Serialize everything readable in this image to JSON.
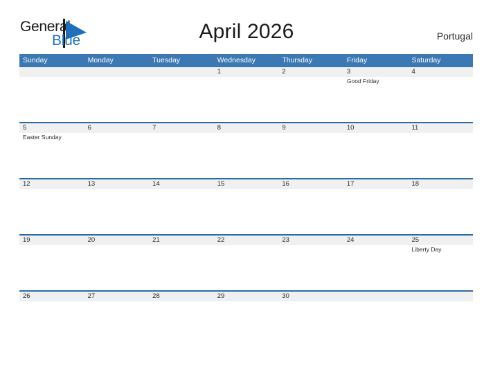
{
  "header": {
    "logo": {
      "word_one": "General",
      "word_two": "Blue",
      "flag_icon": "blue-triangle-flag-icon",
      "brand_color": "#1f6fba"
    },
    "title": "April 2026",
    "country": "Portugal"
  },
  "calendar": {
    "month": "April",
    "year": "2026",
    "header_color": "#3b78b4",
    "row_divider_color": "#2b6ca3",
    "day_strip_color": "#f0f0f0",
    "weekdays": [
      "Sunday",
      "Monday",
      "Tuesday",
      "Wednesday",
      "Thursday",
      "Friday",
      "Saturday"
    ],
    "weeks": [
      {
        "days": [
          {
            "num": "",
            "events": []
          },
          {
            "num": "",
            "events": []
          },
          {
            "num": "",
            "events": []
          },
          {
            "num": "1",
            "events": []
          },
          {
            "num": "2",
            "events": []
          },
          {
            "num": "3",
            "events": [
              "Good Friday"
            ]
          },
          {
            "num": "4",
            "events": []
          }
        ]
      },
      {
        "days": [
          {
            "num": "5",
            "events": [
              "Easter Sunday"
            ]
          },
          {
            "num": "6",
            "events": []
          },
          {
            "num": "7",
            "events": []
          },
          {
            "num": "8",
            "events": []
          },
          {
            "num": "9",
            "events": []
          },
          {
            "num": "10",
            "events": []
          },
          {
            "num": "11",
            "events": []
          }
        ]
      },
      {
        "days": [
          {
            "num": "12",
            "events": []
          },
          {
            "num": "13",
            "events": []
          },
          {
            "num": "14",
            "events": []
          },
          {
            "num": "15",
            "events": []
          },
          {
            "num": "16",
            "events": []
          },
          {
            "num": "17",
            "events": []
          },
          {
            "num": "18",
            "events": []
          }
        ]
      },
      {
        "days": [
          {
            "num": "19",
            "events": []
          },
          {
            "num": "20",
            "events": []
          },
          {
            "num": "21",
            "events": []
          },
          {
            "num": "22",
            "events": []
          },
          {
            "num": "23",
            "events": []
          },
          {
            "num": "24",
            "events": []
          },
          {
            "num": "25",
            "events": [
              "Liberty Day"
            ]
          }
        ]
      },
      {
        "days": [
          {
            "num": "26",
            "events": []
          },
          {
            "num": "27",
            "events": []
          },
          {
            "num": "28",
            "events": []
          },
          {
            "num": "29",
            "events": []
          },
          {
            "num": "30",
            "events": []
          },
          {
            "num": "",
            "events": []
          },
          {
            "num": "",
            "events": []
          }
        ]
      }
    ]
  }
}
